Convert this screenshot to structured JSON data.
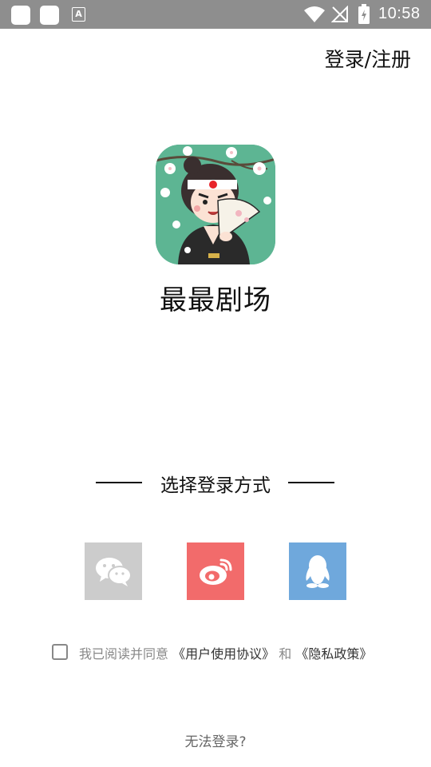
{
  "status_bar": {
    "notification_letter": "A",
    "time": "10:58",
    "icons": [
      "app-icon",
      "app-icon",
      "text-notification-icon",
      "wifi-icon",
      "no-signal-icon",
      "battery-charging-icon"
    ]
  },
  "header": {
    "login_register": "登录/注册"
  },
  "app": {
    "name": "最最剧场",
    "logo_icon": "theater-character-logo"
  },
  "login": {
    "method_title": "选择登录方式",
    "methods": [
      {
        "name": "wechat",
        "icon": "wechat-icon",
        "color": "#cccccc"
      },
      {
        "name": "weibo",
        "icon": "weibo-icon",
        "color": "#f26b6b"
      },
      {
        "name": "qq",
        "icon": "qq-icon",
        "color": "#6fa8dc"
      }
    ]
  },
  "agreement": {
    "prefix": "我已阅读并同意",
    "user_agreement": "《用户使用协议》",
    "and": "和",
    "privacy_policy": "《隐私政策》"
  },
  "footer": {
    "cannot_login": "无法登录?"
  }
}
